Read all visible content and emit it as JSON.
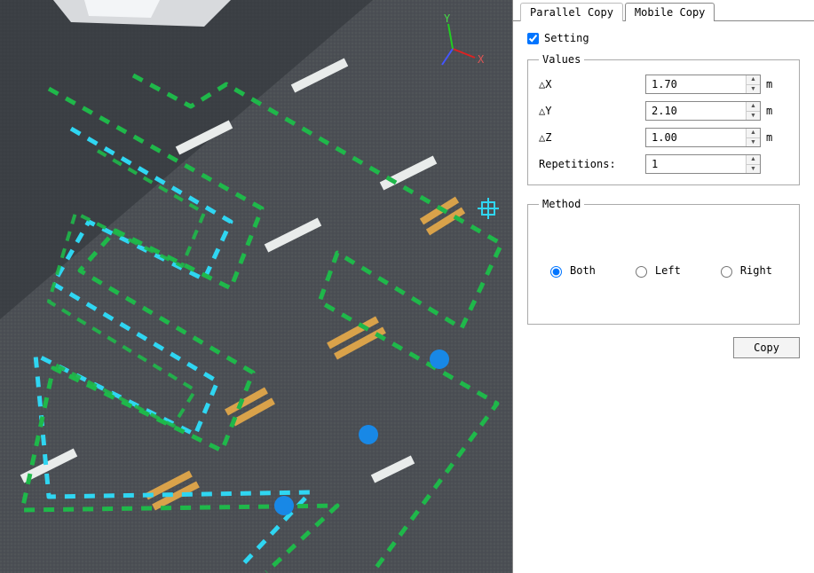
{
  "tabs": {
    "parallel": "Parallel Copy",
    "mobile": "Mobile Copy",
    "active": "mobile"
  },
  "setting": {
    "label": "Setting",
    "checked": true
  },
  "values": {
    "legend": "Values",
    "dx_label": "△X",
    "dx_value": "1.70",
    "dy_label": "△Y",
    "dy_value": "2.10",
    "dz_label": "△Z",
    "dz_value": "1.00",
    "rep_label": "Repetitions:",
    "rep_value": "1",
    "unit": "m"
  },
  "method": {
    "legend": "Method",
    "both": "Both",
    "left": "Left",
    "right": "Right",
    "selected": "both"
  },
  "buttons": {
    "copy": "Copy"
  },
  "viewport": {
    "gizmo": {
      "x_label": "X",
      "y_label": "Y",
      "z_label": ""
    }
  }
}
